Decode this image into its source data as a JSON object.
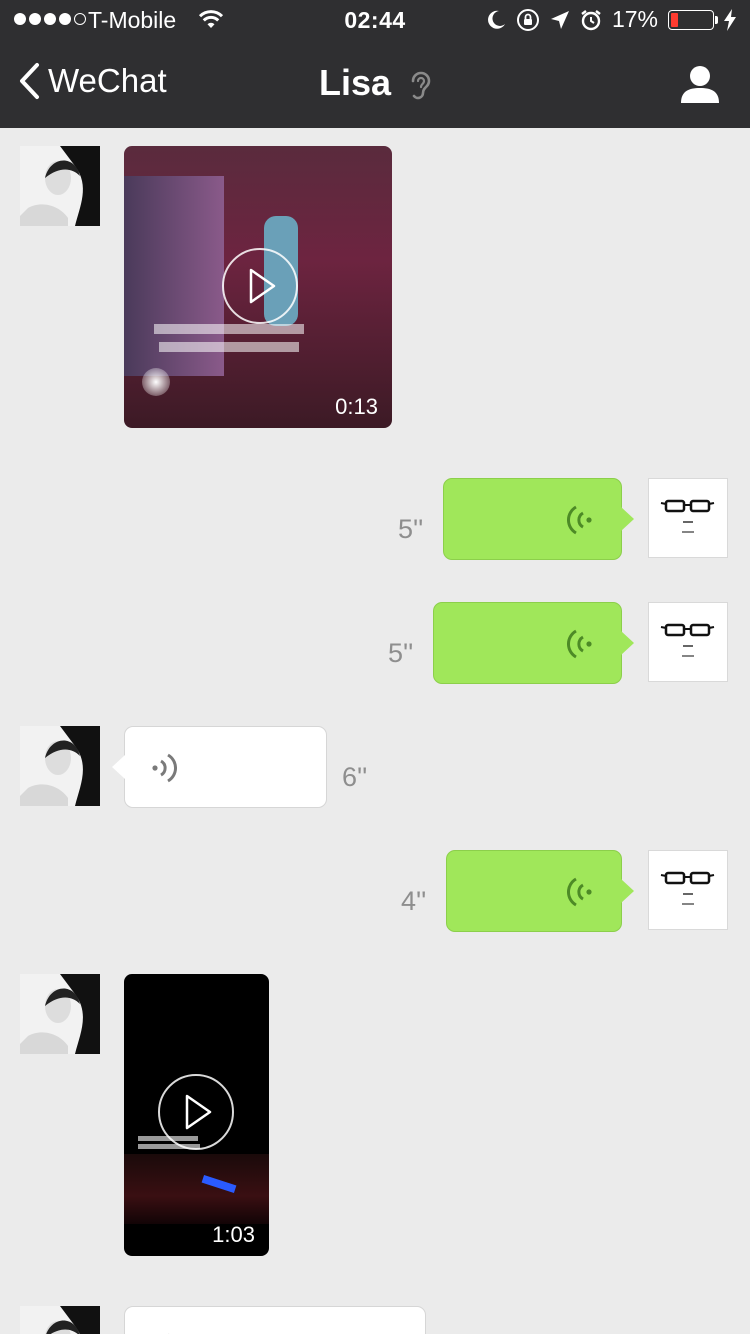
{
  "status_bar": {
    "carrier": "T-Mobile",
    "time": "02:44",
    "battery_percent": "17%",
    "battery_level": 0.17,
    "battery_color": "#ff3b30"
  },
  "nav": {
    "back_label": "WeChat",
    "title": "Lisa",
    "title_icon": "ear-icon",
    "right_icon": "profile-icon",
    "bar_color": "#2f2f31"
  },
  "colors": {
    "background": "#ebebeb",
    "outgoing_bubble": "#a0e75a",
    "incoming_bubble": "#ffffff"
  },
  "messages": [
    {
      "sender": "Lisa",
      "type": "video",
      "duration": "0:13"
    },
    {
      "sender": "me",
      "type": "voice",
      "length": "5''"
    },
    {
      "sender": "me",
      "type": "voice",
      "length": "5''"
    },
    {
      "sender": "Lisa",
      "type": "voice",
      "length": "6''"
    },
    {
      "sender": "me",
      "type": "voice",
      "length": "4''"
    },
    {
      "sender": "Lisa",
      "type": "video",
      "duration": "1:03"
    },
    {
      "sender": "Lisa",
      "type": "voice",
      "length": ""
    }
  ]
}
